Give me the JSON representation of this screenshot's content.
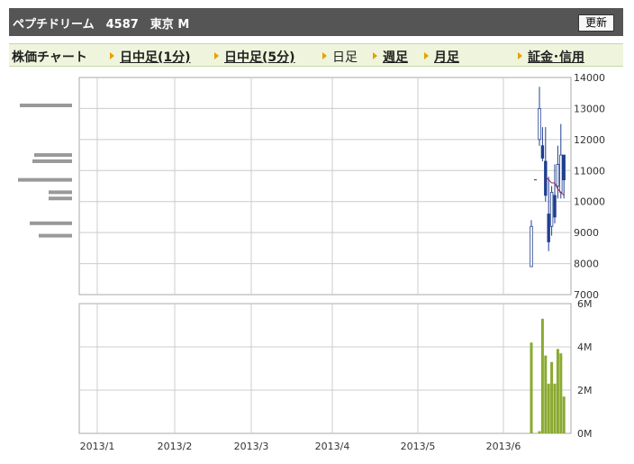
{
  "header": {
    "title": "ペプチドリーム　4587　東京 M",
    "refresh_label": "更新"
  },
  "tabs": {
    "chart_label": "株価チャート",
    "items": [
      "日中足(1分)",
      "日中足(5分)",
      "日足",
      "週足",
      "月足",
      "証金･信用"
    ],
    "selected": "日足"
  },
  "colors": {
    "candle": "#1f3f8f",
    "ma": "#a0204a",
    "volume": "#8aaa30",
    "profile": "#999999",
    "grid": "#cccccc",
    "header_bg": "#555555",
    "tab_bg": "#eef5dc"
  },
  "chart_data": [
    {
      "type": "candlestick",
      "ylim": [
        7000,
        14000
      ],
      "yticks": [
        "14000",
        "13000",
        "12000",
        "11000",
        "10000",
        "9000",
        "8000",
        "7000"
      ],
      "ytick_values": [
        14000,
        13000,
        12000,
        11000,
        10000,
        9000,
        8000,
        7000
      ],
      "xticks": [
        "2013/1",
        "2013/2",
        "2013/3",
        "2013/4",
        "2013/5",
        "2013/6"
      ],
      "candles": [
        {
          "o": 7900,
          "h": 9400,
          "l": 7900,
          "c": 9200
        },
        {
          "o": 12000,
          "h": 13700,
          "l": 11800,
          "c": 13000
        },
        {
          "o": 11800,
          "h": 12400,
          "l": 11300,
          "c": 11400
        },
        {
          "o": 11300,
          "h": 12400,
          "l": 10000,
          "c": 10200
        },
        {
          "o": 9600,
          "h": 10800,
          "l": 8400,
          "c": 8700
        },
        {
          "o": 9200,
          "h": 10500,
          "l": 8900,
          "c": 10300
        },
        {
          "o": 10200,
          "h": 11200,
          "l": 9300,
          "c": 9500
        },
        {
          "o": 10500,
          "h": 11800,
          "l": 10100,
          "c": 11200
        },
        {
          "o": 10300,
          "h": 12500,
          "l": 10100,
          "c": 11500
        },
        {
          "o": 11500,
          "h": 11500,
          "l": 10100,
          "c": 10700
        }
      ],
      "ma": [
        10800,
        10700,
        10600,
        10600,
        10400,
        10300,
        10200
      ],
      "ma_marker": 10700,
      "volume_profile": [
        {
          "price": 13100,
          "vol": 0.58
        },
        {
          "price": 11500,
          "vol": 0.42
        },
        {
          "price": 11300,
          "vol": 0.44
        },
        {
          "price": 10700,
          "vol": 0.6
        },
        {
          "price": 10300,
          "vol": 0.26
        },
        {
          "price": 10100,
          "vol": 0.26
        },
        {
          "price": 9300,
          "vol": 0.47
        },
        {
          "price": 8900,
          "vol": 0.37
        }
      ]
    },
    {
      "type": "bar",
      "ylim": [
        0,
        6
      ],
      "unit": "M",
      "yticks": [
        "6M",
        "4M",
        "2M",
        "0M"
      ],
      "ytick_values": [
        6,
        4,
        2,
        0
      ],
      "values": [
        4.2,
        0.1,
        5.3,
        3.6,
        2.3,
        3.3,
        2.3,
        3.9,
        3.7,
        1.7
      ]
    }
  ]
}
